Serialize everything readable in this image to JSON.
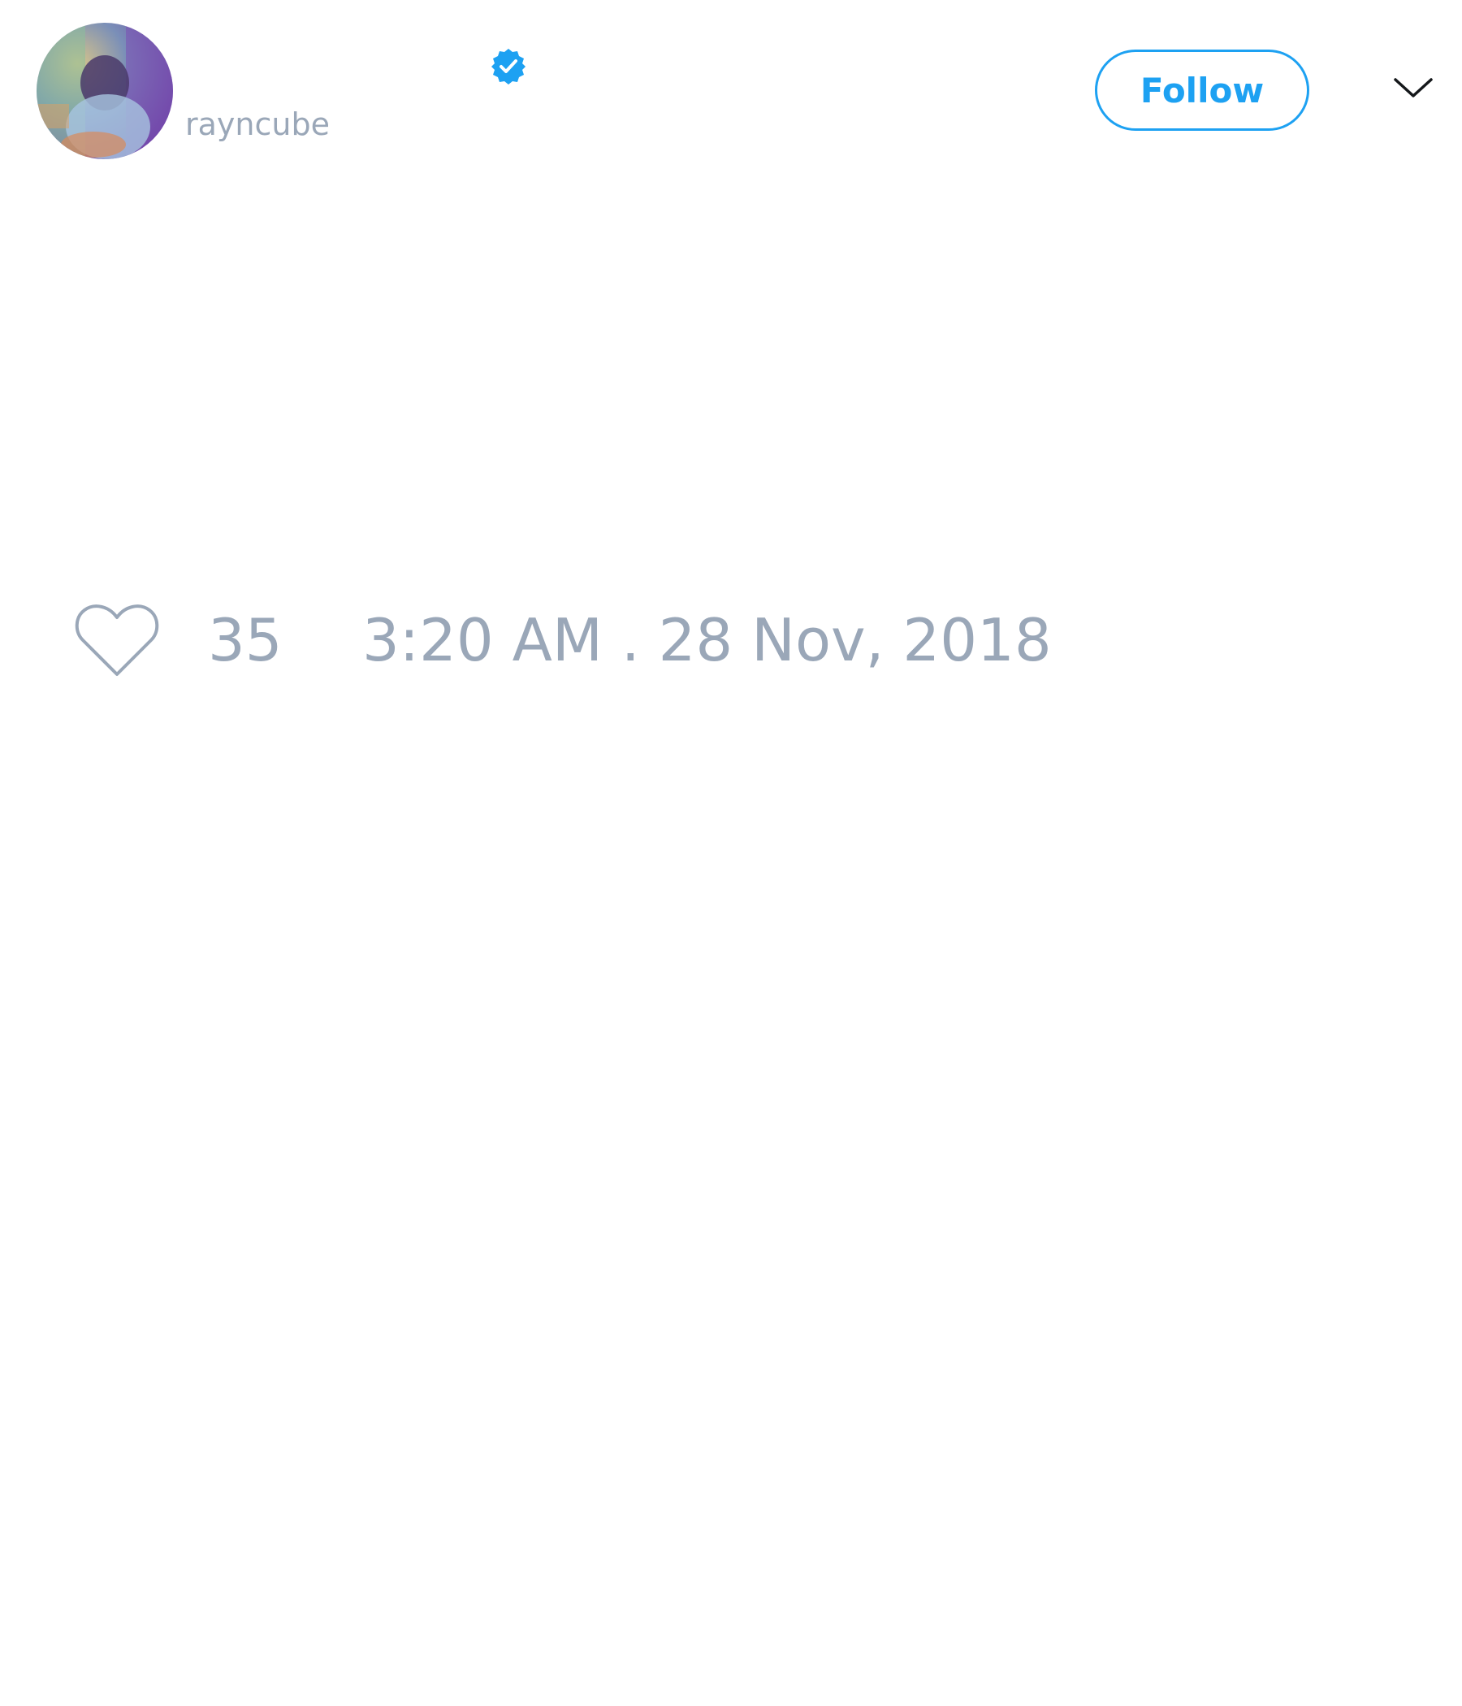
{
  "tweet": {
    "display_name": "",
    "handle": "rayncube",
    "verified": true,
    "follow_label": "Follow",
    "like_count": "35",
    "timestamp": "3:20 AM . 28 Nov, 2018",
    "text": ""
  },
  "icons": {
    "avatar": "avatar-photo",
    "verified": "verified-badge-icon",
    "menu": "chevron-down-icon",
    "like": "heart-outline-icon"
  },
  "colors": {
    "accent": "#1da1f2",
    "muted_text": "#9aa7b8",
    "background": "#ffffff"
  }
}
